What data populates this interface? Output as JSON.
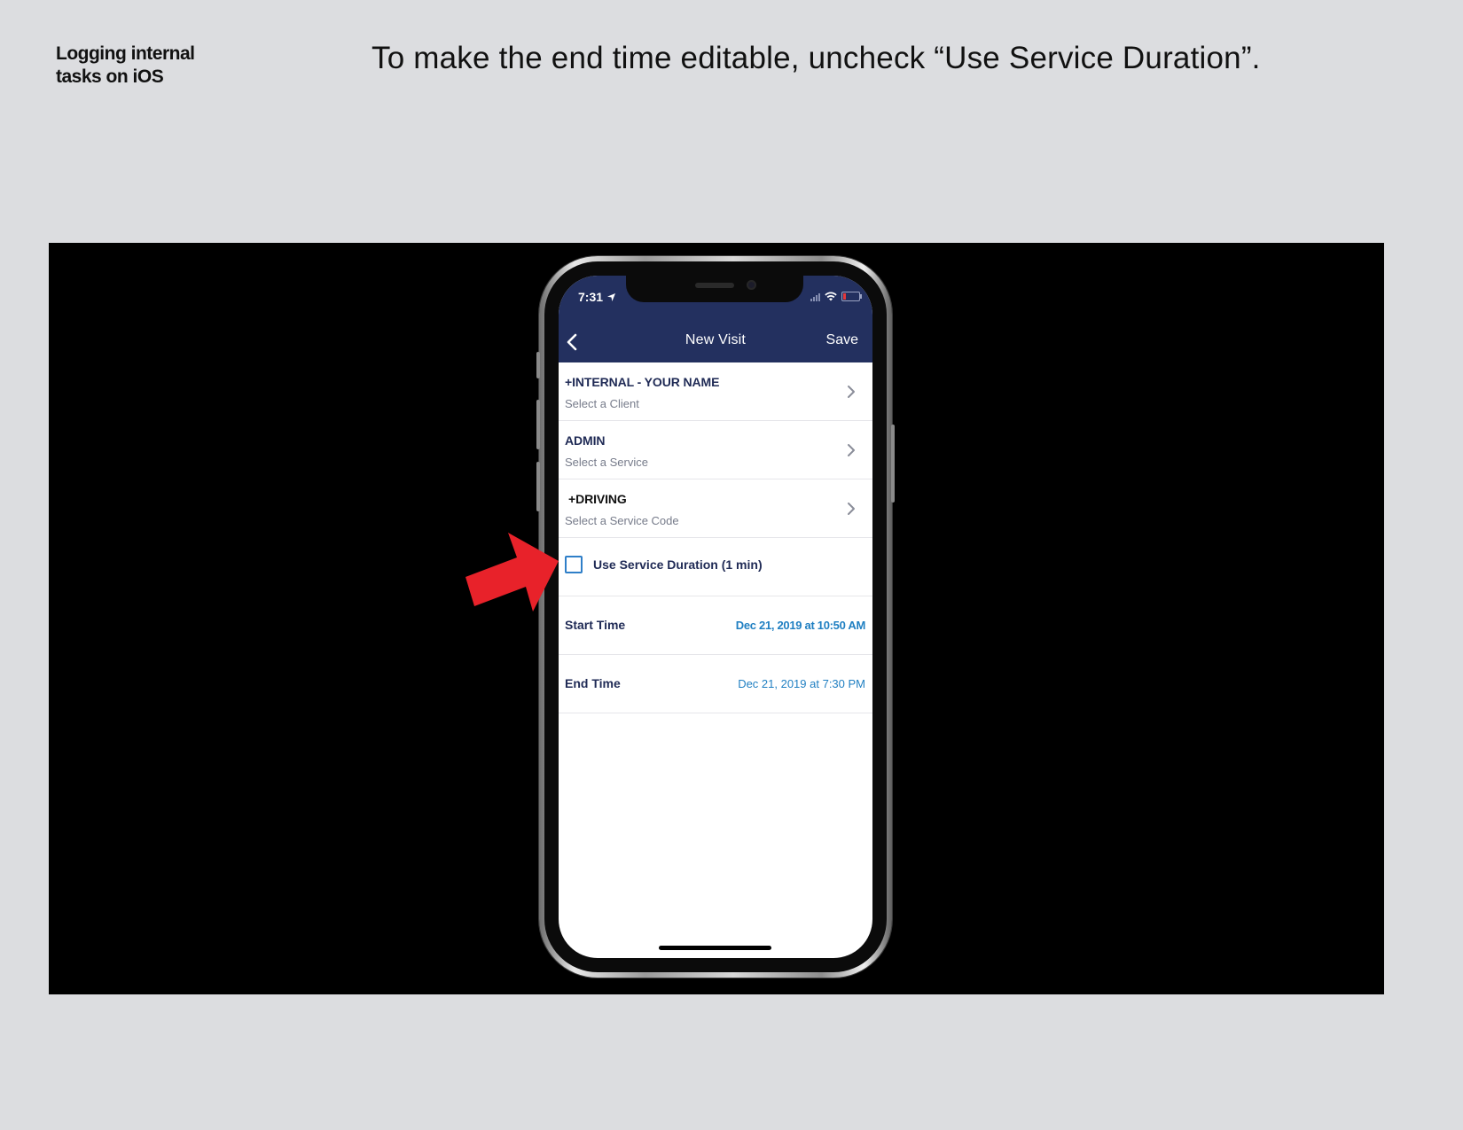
{
  "doc": {
    "title_line1": "Logging internal",
    "title_line2": "tasks on iOS",
    "instruction": "To make the end time editable, uncheck “Use Service Duration”."
  },
  "status_bar": {
    "time": "7:31"
  },
  "nav": {
    "title": "New Visit",
    "save_label": "Save",
    "back_icon": "chevron-left-icon"
  },
  "rows": {
    "client": {
      "value": "+INTERNAL - YOUR NAME",
      "placeholder": "Select a Client"
    },
    "service": {
      "value": "ADMIN",
      "placeholder": "Select a Service"
    },
    "service_code": {
      "value": "+DRIVING",
      "placeholder": "Select a Service Code"
    }
  },
  "duration": {
    "label": "Use Service Duration (1 min)",
    "checked": false
  },
  "times": {
    "start_label": "Start Time",
    "start_value": "Dec 21, 2019 at 10:50 AM",
    "end_label": "End Time",
    "end_value": "Dec 21, 2019 at 7:30 PM"
  },
  "colors": {
    "nav_bar": "#23305f",
    "accent_blue": "#1f7fc2",
    "arrow_red": "#e8222a",
    "text_dark": "#1f2a55"
  }
}
